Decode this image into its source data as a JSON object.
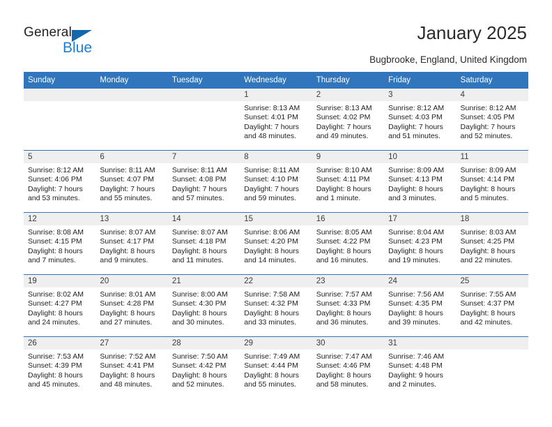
{
  "brand": {
    "name_part1": "General",
    "name_part2": "Blue",
    "triangle_color": "#1267ad",
    "blue_color": "#1a7fd4"
  },
  "header": {
    "title": "January 2025",
    "subtitle": "Bugbrooke, England, United Kingdom"
  },
  "theme": {
    "header_bg": "#3176bc",
    "daynum_band_bg": "#efefef",
    "grid_line": "#3176bc",
    "text": "#222222"
  },
  "weekdays": [
    "Sunday",
    "Monday",
    "Tuesday",
    "Wednesday",
    "Thursday",
    "Friday",
    "Saturday"
  ],
  "labels": {
    "sunrise_prefix": "Sunrise:",
    "sunset_prefix": "Sunset:",
    "daylight_prefix": "Daylight:"
  },
  "weeks": [
    [
      {
        "day": "",
        "line1": "",
        "line2": "",
        "line3": "",
        "line4": ""
      },
      {
        "day": "",
        "line1": "",
        "line2": "",
        "line3": "",
        "line4": ""
      },
      {
        "day": "",
        "line1": "",
        "line2": "",
        "line3": "",
        "line4": ""
      },
      {
        "day": "1",
        "line1": "Sunrise: 8:13 AM",
        "line2": "Sunset: 4:01 PM",
        "line3": "Daylight: 7 hours",
        "line4": "and 48 minutes."
      },
      {
        "day": "2",
        "line1": "Sunrise: 8:13 AM",
        "line2": "Sunset: 4:02 PM",
        "line3": "Daylight: 7 hours",
        "line4": "and 49 minutes."
      },
      {
        "day": "3",
        "line1": "Sunrise: 8:12 AM",
        "line2": "Sunset: 4:03 PM",
        "line3": "Daylight: 7 hours",
        "line4": "and 51 minutes."
      },
      {
        "day": "4",
        "line1": "Sunrise: 8:12 AM",
        "line2": "Sunset: 4:05 PM",
        "line3": "Daylight: 7 hours",
        "line4": "and 52 minutes."
      }
    ],
    [
      {
        "day": "5",
        "line1": "Sunrise: 8:12 AM",
        "line2": "Sunset: 4:06 PM",
        "line3": "Daylight: 7 hours",
        "line4": "and 53 minutes."
      },
      {
        "day": "6",
        "line1": "Sunrise: 8:11 AM",
        "line2": "Sunset: 4:07 PM",
        "line3": "Daylight: 7 hours",
        "line4": "and 55 minutes."
      },
      {
        "day": "7",
        "line1": "Sunrise: 8:11 AM",
        "line2": "Sunset: 4:08 PM",
        "line3": "Daylight: 7 hours",
        "line4": "and 57 minutes."
      },
      {
        "day": "8",
        "line1": "Sunrise: 8:11 AM",
        "line2": "Sunset: 4:10 PM",
        "line3": "Daylight: 7 hours",
        "line4": "and 59 minutes."
      },
      {
        "day": "9",
        "line1": "Sunrise: 8:10 AM",
        "line2": "Sunset: 4:11 PM",
        "line3": "Daylight: 8 hours",
        "line4": "and 1 minute."
      },
      {
        "day": "10",
        "line1": "Sunrise: 8:09 AM",
        "line2": "Sunset: 4:13 PM",
        "line3": "Daylight: 8 hours",
        "line4": "and 3 minutes."
      },
      {
        "day": "11",
        "line1": "Sunrise: 8:09 AM",
        "line2": "Sunset: 4:14 PM",
        "line3": "Daylight: 8 hours",
        "line4": "and 5 minutes."
      }
    ],
    [
      {
        "day": "12",
        "line1": "Sunrise: 8:08 AM",
        "line2": "Sunset: 4:15 PM",
        "line3": "Daylight: 8 hours",
        "line4": "and 7 minutes."
      },
      {
        "day": "13",
        "line1": "Sunrise: 8:07 AM",
        "line2": "Sunset: 4:17 PM",
        "line3": "Daylight: 8 hours",
        "line4": "and 9 minutes."
      },
      {
        "day": "14",
        "line1": "Sunrise: 8:07 AM",
        "line2": "Sunset: 4:18 PM",
        "line3": "Daylight: 8 hours",
        "line4": "and 11 minutes."
      },
      {
        "day": "15",
        "line1": "Sunrise: 8:06 AM",
        "line2": "Sunset: 4:20 PM",
        "line3": "Daylight: 8 hours",
        "line4": "and 14 minutes."
      },
      {
        "day": "16",
        "line1": "Sunrise: 8:05 AM",
        "line2": "Sunset: 4:22 PM",
        "line3": "Daylight: 8 hours",
        "line4": "and 16 minutes."
      },
      {
        "day": "17",
        "line1": "Sunrise: 8:04 AM",
        "line2": "Sunset: 4:23 PM",
        "line3": "Daylight: 8 hours",
        "line4": "and 19 minutes."
      },
      {
        "day": "18",
        "line1": "Sunrise: 8:03 AM",
        "line2": "Sunset: 4:25 PM",
        "line3": "Daylight: 8 hours",
        "line4": "and 22 minutes."
      }
    ],
    [
      {
        "day": "19",
        "line1": "Sunrise: 8:02 AM",
        "line2": "Sunset: 4:27 PM",
        "line3": "Daylight: 8 hours",
        "line4": "and 24 minutes."
      },
      {
        "day": "20",
        "line1": "Sunrise: 8:01 AM",
        "line2": "Sunset: 4:28 PM",
        "line3": "Daylight: 8 hours",
        "line4": "and 27 minutes."
      },
      {
        "day": "21",
        "line1": "Sunrise: 8:00 AM",
        "line2": "Sunset: 4:30 PM",
        "line3": "Daylight: 8 hours",
        "line4": "and 30 minutes."
      },
      {
        "day": "22",
        "line1": "Sunrise: 7:58 AM",
        "line2": "Sunset: 4:32 PM",
        "line3": "Daylight: 8 hours",
        "line4": "and 33 minutes."
      },
      {
        "day": "23",
        "line1": "Sunrise: 7:57 AM",
        "line2": "Sunset: 4:33 PM",
        "line3": "Daylight: 8 hours",
        "line4": "and 36 minutes."
      },
      {
        "day": "24",
        "line1": "Sunrise: 7:56 AM",
        "line2": "Sunset: 4:35 PM",
        "line3": "Daylight: 8 hours",
        "line4": "and 39 minutes."
      },
      {
        "day": "25",
        "line1": "Sunrise: 7:55 AM",
        "line2": "Sunset: 4:37 PM",
        "line3": "Daylight: 8 hours",
        "line4": "and 42 minutes."
      }
    ],
    [
      {
        "day": "26",
        "line1": "Sunrise: 7:53 AM",
        "line2": "Sunset: 4:39 PM",
        "line3": "Daylight: 8 hours",
        "line4": "and 45 minutes."
      },
      {
        "day": "27",
        "line1": "Sunrise: 7:52 AM",
        "line2": "Sunset: 4:41 PM",
        "line3": "Daylight: 8 hours",
        "line4": "and 48 minutes."
      },
      {
        "day": "28",
        "line1": "Sunrise: 7:50 AM",
        "line2": "Sunset: 4:42 PM",
        "line3": "Daylight: 8 hours",
        "line4": "and 52 minutes."
      },
      {
        "day": "29",
        "line1": "Sunrise: 7:49 AM",
        "line2": "Sunset: 4:44 PM",
        "line3": "Daylight: 8 hours",
        "line4": "and 55 minutes."
      },
      {
        "day": "30",
        "line1": "Sunrise: 7:47 AM",
        "line2": "Sunset: 4:46 PM",
        "line3": "Daylight: 8 hours",
        "line4": "and 58 minutes."
      },
      {
        "day": "31",
        "line1": "Sunrise: 7:46 AM",
        "line2": "Sunset: 4:48 PM",
        "line3": "Daylight: 9 hours",
        "line4": "and 2 minutes."
      },
      {
        "day": "",
        "line1": "",
        "line2": "",
        "line3": "",
        "line4": ""
      }
    ]
  ]
}
